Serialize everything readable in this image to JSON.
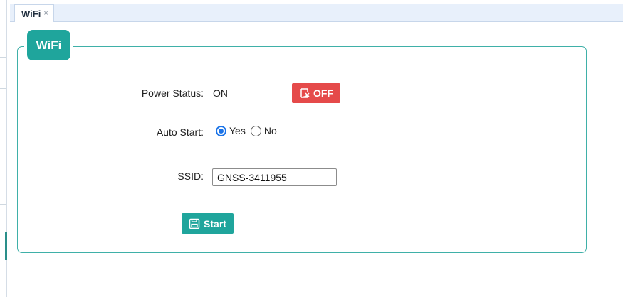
{
  "tab": {
    "label": "WiFi",
    "close": "×"
  },
  "panel": {
    "legend": "WiFi"
  },
  "form": {
    "power_status_label": "Power Status:",
    "power_status_value": "ON",
    "off_button_label": "OFF",
    "auto_start_label": "Auto Start:",
    "auto_start_options": [
      "Yes",
      "No"
    ],
    "auto_start_selected": "Yes",
    "ssid_label": "SSID:",
    "ssid_value": "GNSS-3411955",
    "start_button_label": "Start"
  },
  "icons": {
    "off_button_icon": "power-off-icon",
    "start_button_icon": "save-icon"
  },
  "colors": {
    "accent": "#1fa59c",
    "danger": "#e54a4a",
    "radio": "#1a73e8"
  }
}
